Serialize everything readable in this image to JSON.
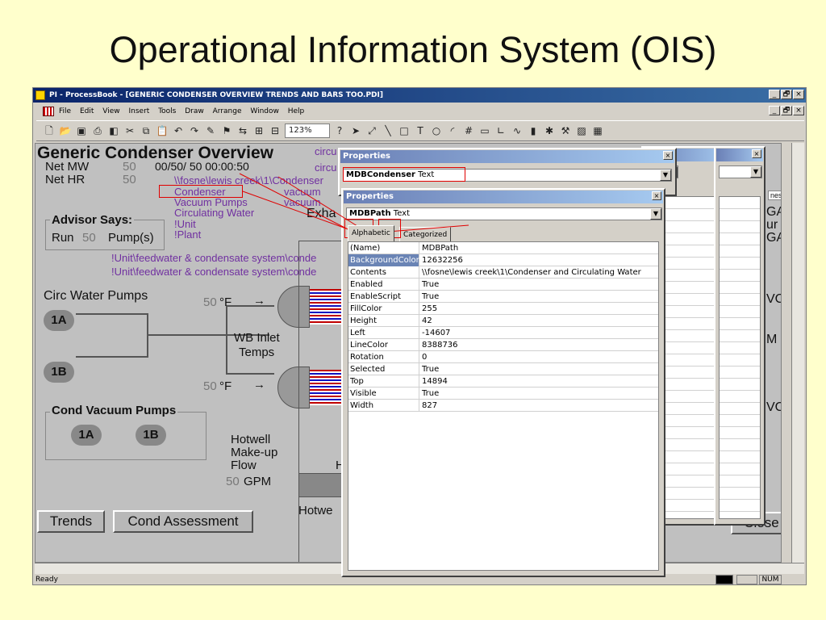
{
  "slide": {
    "title": "Operational Information System (OIS)"
  },
  "window": {
    "title": "PI - ProcessBook - [GENERIC CONDENSER OVERVIEW TRENDS AND BARS TOO.PDI]",
    "controls": [
      "_",
      "🗗",
      "×"
    ]
  },
  "menu": [
    "File",
    "Edit",
    "View",
    "Insert",
    "Tools",
    "Draw",
    "Arrange",
    "Window",
    "Help"
  ],
  "toolbar": {
    "zoom": "123%",
    "icons": [
      "new-icon",
      "open-icon",
      "save-icon",
      "print-icon",
      "preview-icon",
      "cut-icon",
      "copy-icon",
      "paste-icon",
      "undo-icon",
      "redo-icon",
      "pointer-icon",
      "select-icon",
      "line-icon",
      "rectangle-icon",
      "text-icon",
      "ellipse-icon",
      "arc-icon",
      "value-icon",
      "trend-icon",
      "bar-icon"
    ]
  },
  "canvas": {
    "header": "Generic Condenser Overview",
    "net_mw_label": "Net MW",
    "net_mw_value": "50",
    "net_mw_time": "00/50/  50    00:00:50",
    "net_hr_label": "Net HR",
    "net_hr_value": "50",
    "links": [
      "\\\\fosne\\lewis creek\\1\\Condenser",
      "Condenser",
      "Vacuum Pumps",
      "Circulating Water",
      "!Unit",
      "!Plant"
    ],
    "circ_labels": [
      "circu",
      "circu"
    ],
    "vacuum_labels": [
      "vacuum",
      "vacuum"
    ],
    "exha": "Exha",
    "advisor_title": "Advisor Says:",
    "advisor_run": "Run",
    "advisor_value": "50",
    "advisor_pumps": "Pump(s)",
    "unit_paths": [
      "!Unit\\feedwater & condensate system\\conde",
      "!Unit\\feedwater & condensate system\\conde"
    ],
    "circ_pumps_title": "Circ Water Pumps",
    "pump_1a": "1A",
    "pump_1b": "1B",
    "temp_top_value": "50",
    "temp_top_unit": "°F",
    "temp_bottom_value": "50",
    "temp_bottom_unit": "°F",
    "wb_inlet": "WB Inlet",
    "temps": "Temps",
    "cond_vacuum_title": "Cond Vacuum Pumps",
    "vac_1a": "1A",
    "vac_1b": "1B",
    "hotwell_l1": "Hotwell",
    "hotwell_l2": "Make-up",
    "hotwell_l3": "Flow",
    "gpm_value": "50",
    "gpm_unit": "GPM",
    "hotwe": "Hotwe",
    "h_frag": "H",
    "trends_btn": "Trends",
    "cond_assess_btn": "Cond Assessment",
    "right_frags": [
      "ness_EU]",
      "GA",
      "ur",
      "GA",
      "VC",
      "M",
      "VC"
    ],
    "close_btn": "Close"
  },
  "status": {
    "ready": "Ready",
    "ind1": "",
    "num": "NUM"
  },
  "properties_back": {
    "title": "Properties",
    "object": "MDBCondenser",
    "type": "Text"
  },
  "properties_front": {
    "title": "Properties",
    "object": "MDBPath",
    "type": "Text",
    "tab_alpha": "Alphabetic",
    "tab_cat": "Categorized",
    "rows": [
      {
        "k": "(Name)",
        "v": "MDBPath"
      },
      {
        "k": "BackgroundColor",
        "v": "12632256"
      },
      {
        "k": "Contents",
        "v": "\\\\fosne\\lewis creek\\1\\Condenser and Circulating Water"
      },
      {
        "k": "Enabled",
        "v": "True"
      },
      {
        "k": "EnableScript",
        "v": "True"
      },
      {
        "k": "FillColor",
        "v": "255"
      },
      {
        "k": "Height",
        "v": "42"
      },
      {
        "k": "Left",
        "v": "-14607"
      },
      {
        "k": "LineColor",
        "v": "8388736"
      },
      {
        "k": "Rotation",
        "v": "0"
      },
      {
        "k": "Selected",
        "v": "True"
      },
      {
        "k": "Top",
        "v": "14894"
      },
      {
        "k": "Visible",
        "v": "True"
      },
      {
        "k": "Width",
        "v": "827"
      }
    ]
  }
}
